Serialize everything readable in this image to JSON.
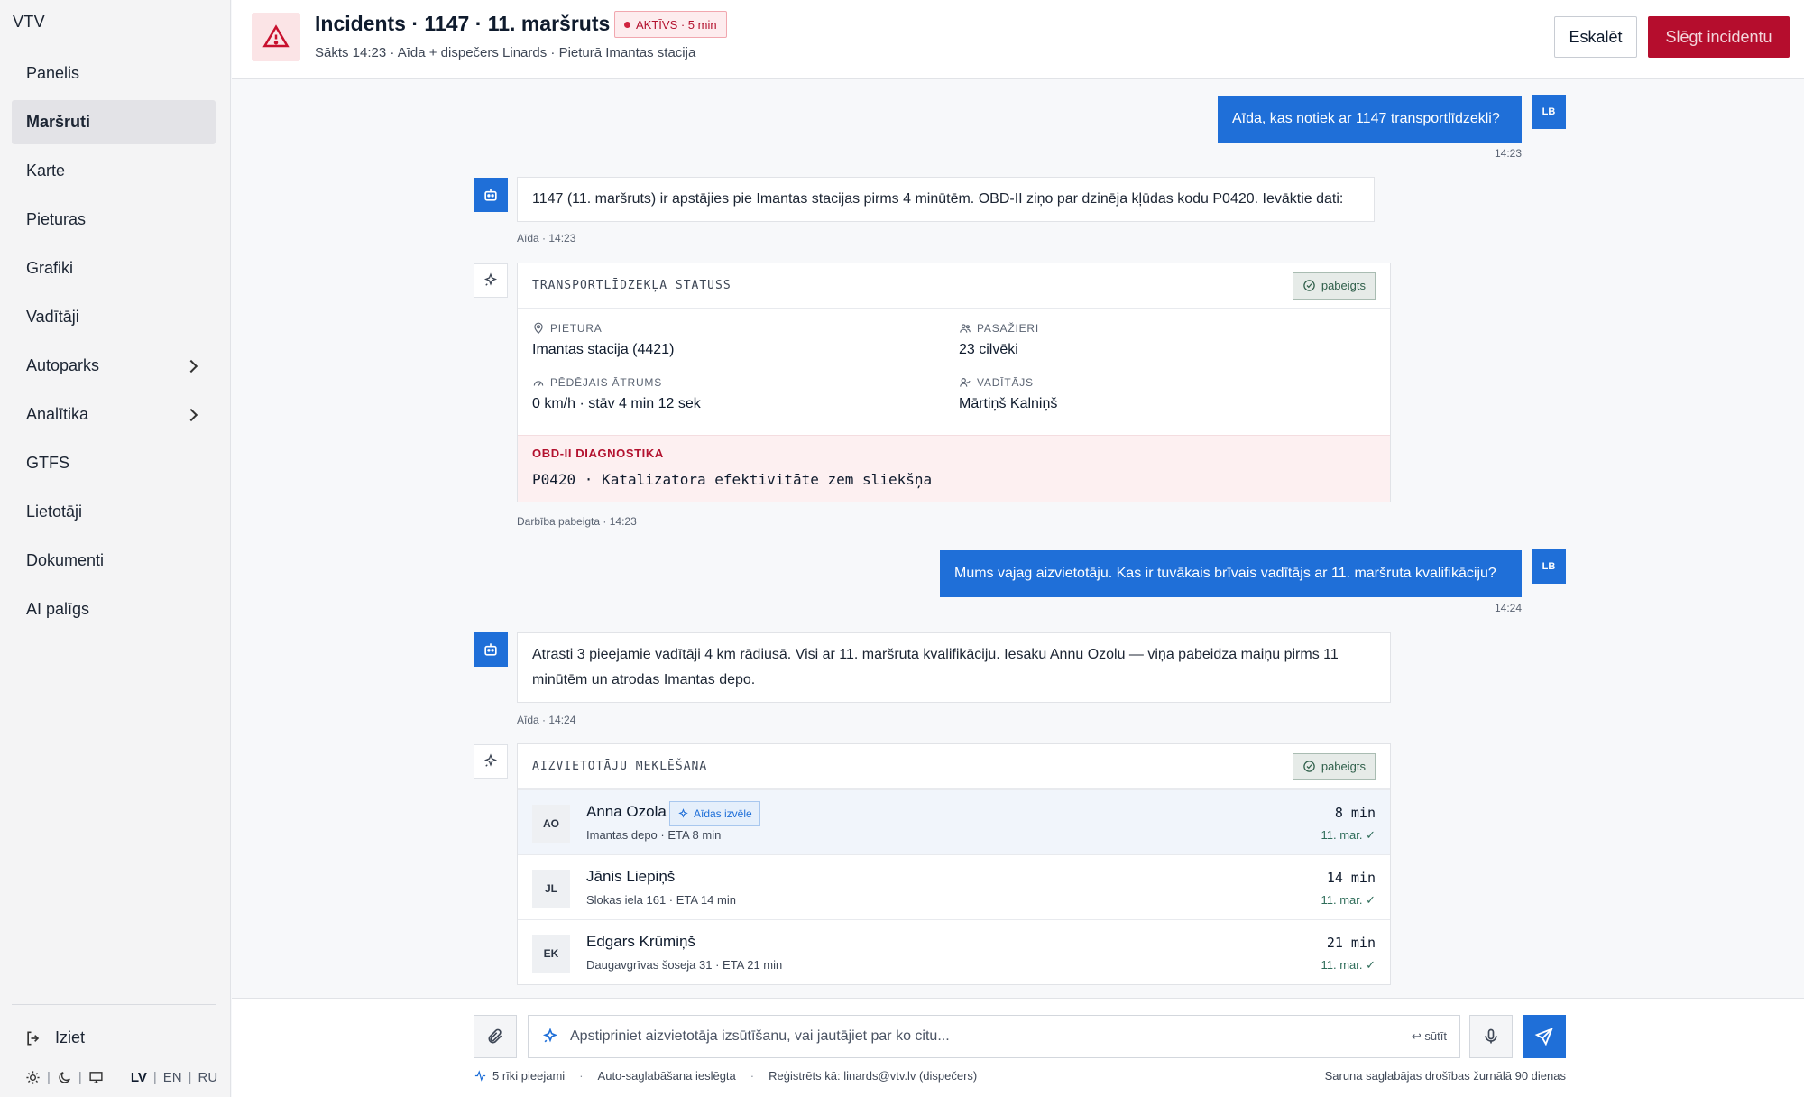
{
  "sidebar": {
    "brand": "VTV",
    "items": [
      {
        "label": "Panelis"
      },
      {
        "label": "Maršruti"
      },
      {
        "label": "Karte"
      },
      {
        "label": "Pieturas"
      },
      {
        "label": "Grafiki"
      },
      {
        "label": "Vadītāji"
      },
      {
        "label": "Autoparks"
      },
      {
        "label": "Analītika"
      },
      {
        "label": "GTFS"
      },
      {
        "label": "Lietotāji"
      },
      {
        "label": "Dokumenti"
      },
      {
        "label": "AI palīgs"
      }
    ],
    "active_item": "Maršruti",
    "logout": "Iziet",
    "languages": [
      "LV",
      "EN",
      "RU"
    ],
    "selected_language": "LV"
  },
  "header": {
    "title": "Incidents · 1147 · 11. maršruts",
    "status_badge": "AKTĪVS · 5 min",
    "subtitle": "Sākts 14:23 · Aīda + dispečers Linards · Pieturā Imantas stacija",
    "escalate_label": "Eskalēt",
    "close_label": "Slēgt incidentu"
  },
  "chat": {
    "user_initials": "LB",
    "msg1": {
      "text": "Aīda, kas notiek ar 1147 transportlīdzekli?",
      "time": "14:23"
    },
    "msg2": {
      "text": "1147 (11. maršruts) ir apstājies pie Imantas stacijas pirms 4 minūtēm. OBD-II ziņo par dzinēja kļūdas kodu P0420. Ievāktie dati:",
      "meta": "Aīda · 14:23"
    },
    "status_card": {
      "title": "TRANSPORTLĪDZEKĻA STATUSS",
      "badge": "pabeigts",
      "stop_label": "PIETURA",
      "stop_value": "Imantas stacija (4421)",
      "pass_label": "PASAŽIERI",
      "pass_value": "23 cilvēki",
      "speed_label": "PĒDĒJAIS ĀTRUMS",
      "speed_value": "0 km/h · stāv 4 min 12 sek",
      "driver_label": "VADĪTĀJS",
      "driver_value": "Mārtiņš Kalniņš",
      "obd_label": "OBD-II DIAGNOSTIKA",
      "obd_value": "P0420 · Katalizatora efektivitāte zem sliekšņa",
      "meta": "Darbība pabeigta · 14:23"
    },
    "msg3": {
      "text": "Mums vajag aizvietotāju. Kas ir tuvākais brīvais vadītājs ar 11. maršruta kvalifikāciju?",
      "time": "14:24"
    },
    "msg4": {
      "text": "Atrasti 3 pieejamie vadītāji 4 km rādiusā. Visi ar 11. maršruta kvalifikāciju. Iesaku Annu Ozolu — viņa pabeidza maiņu pirms 11 minūtēm un atrodas Imantas depo.",
      "meta": "Aīda · 14:24"
    },
    "replacement_card": {
      "title": "AIZVIETOTĀJU MEKLĒŠANA",
      "badge": "pabeigts",
      "choice_badge": "Aīdas izvēle",
      "rows": [
        {
          "initials": "AO",
          "name": "Anna Ozola",
          "sub": "Imantas depo · ETA 8 min",
          "eta": "8 min",
          "qual": "11. mar. ✓"
        },
        {
          "initials": "JL",
          "name": "Jānis Liepiņš",
          "sub": "Slokas iela 161 · ETA 14 min",
          "eta": "14 min",
          "qual": "11. mar. ✓"
        },
        {
          "initials": "EK",
          "name": "Edgars Krūmiņš",
          "sub": "Daugavgrīvas šoseja 31 · ETA 21 min",
          "eta": "21 min",
          "qual": "11. mar. ✓"
        }
      ]
    }
  },
  "composer": {
    "placeholder": "Apstipriniet aizvietotāja izsūtīšanu, vai jautājiet par ko citu...",
    "send_hint": "↩ sūtīt",
    "footer": {
      "tools": "5 rīki pieejami",
      "autosave": "Auto-saglabāšana ieslēgta",
      "registered": "Reģistrēts kā: linards@vtv.lv (dispečers)",
      "retention": "Saruna saglabājas drošības žurnālā 90 dienas"
    }
  },
  "colors": {
    "accent": "#1f6fd8",
    "danger": "#b50d2d",
    "success": "#2f6d5a"
  }
}
